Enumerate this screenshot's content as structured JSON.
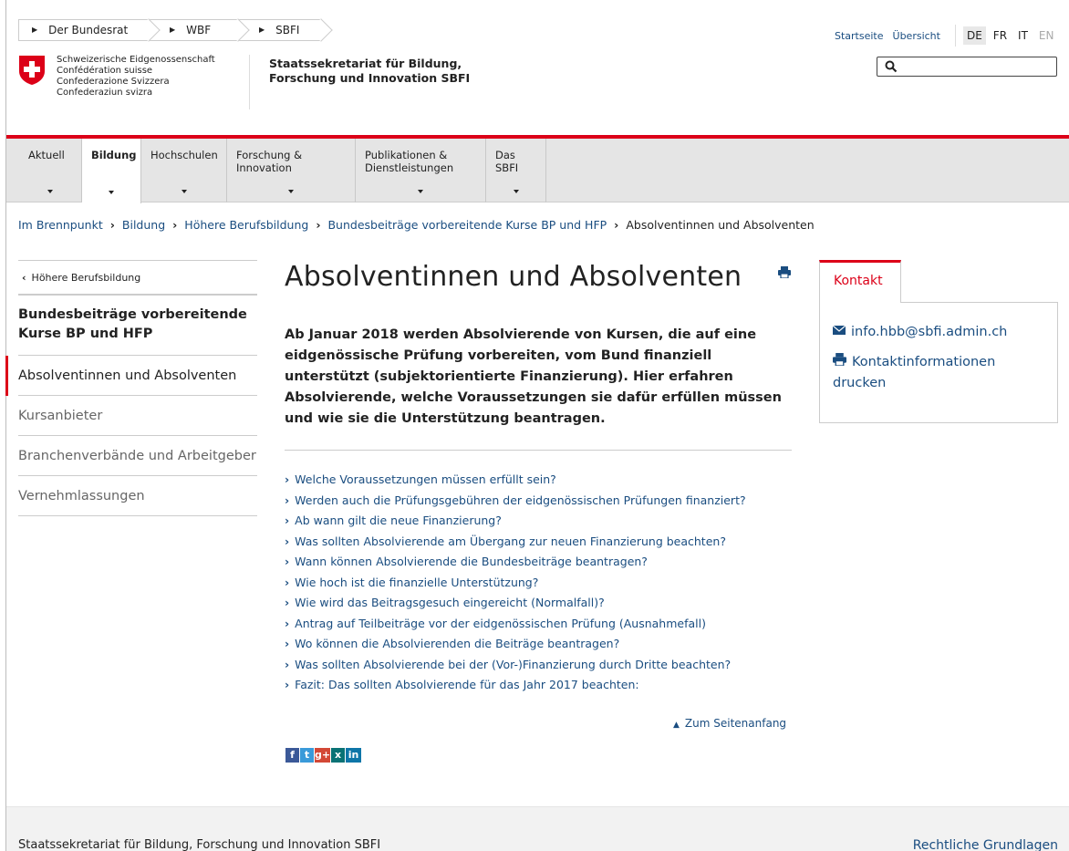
{
  "federal_breadcrumb": [
    "Der Bundesrat",
    "WBF",
    "SBFI"
  ],
  "meta_links": [
    "Startseite",
    "Übersicht"
  ],
  "languages": [
    "DE",
    "FR",
    "IT",
    "EN"
  ],
  "logo": {
    "lines": [
      "Schweizerische Eidgenossenschaft",
      "Confédération suisse",
      "Confederazione Svizzera",
      "Confederaziun svizra"
    ]
  },
  "department": {
    "line1": "Staatssekretariat für Bildung,",
    "line2": "Forschung und Innovation SBFI"
  },
  "search": {
    "placeholder": "",
    "value": ""
  },
  "nav": [
    {
      "line1": "Aktuell",
      "line2": ""
    },
    {
      "line1": "Bildung",
      "line2": ""
    },
    {
      "line1": "Hochschulen",
      "line2": ""
    },
    {
      "line1": "Forschung &",
      "line2": "Innovation"
    },
    {
      "line1": "Publikationen &",
      "line2": "Dienstleistungen"
    },
    {
      "line1": "Das SBFI",
      "line2": ""
    }
  ],
  "page_breadcrumb": [
    "Im Brennpunkt",
    "Bildung",
    "Höhere Berufsbildung",
    "Bundesbeiträge vorbereitende Kurse BP und HFP",
    "Absolventinnen und Absolventen"
  ],
  "left_nav": {
    "back": "Höhere Berufsbildung",
    "parent": "Bundesbeiträge vorbereitende Kurse BP und HFP",
    "items": [
      "Absolventinnen und Absolventen",
      "Kursanbieter",
      "Branchenverbände und Arbeitgeber",
      "Vernehmlassungen"
    ]
  },
  "main": {
    "title": "Absolventinnen und Absolventen",
    "lead": "Ab Januar 2018 werden Absolvierende von Kursen, die auf eine eidgenössische Prüfung vorbereiten, vom Bund finanziell unterstützt (subjektorientierte Finanzierung). Hier erfahren Absolvierende, welche Voraussetzungen sie dafür erfüllen müssen und wie sie die Unterstützung beantragen.",
    "toc": [
      "Welche Voraussetzungen müssen erfüllt sein?",
      "Werden auch die Prüfungsgebühren der eidgenössischen Prüfungen finanziert?",
      "Ab wann gilt die neue Finanzierung?",
      "Was sollten Absolvierende am Übergang zur neuen Finanzierung beachten?",
      "Wann können Absolvierende die Bundesbeiträge beantragen?",
      "Wie hoch ist die finanzielle Unterstützung?",
      "Wie wird das Beitragsgesuch eingereicht (Normalfall)?",
      "Antrag auf Teilbeiträge vor der eidgenössischen Prüfung (Ausnahmefall)",
      "Wo können die Absolvierenden die Beiträge beantragen?",
      "Was sollten Absolvierende bei der (Vor-)Finanzierung durch Dritte beachten?",
      "Fazit: Das sollten Absolvierende für das Jahr 2017 beachten:"
    ],
    "to_top": "Zum Seitenanfang"
  },
  "social": [
    "f",
    "t",
    "g+",
    "x",
    "in"
  ],
  "contact": {
    "tab": "Kontakt",
    "email": "info.hbb@sbfi.admin.ch",
    "print": "Kontaktinformationen drucken"
  },
  "footer": {
    "text": "Staatssekretariat für Bildung, Forschung und Innovation SBFI",
    "link": "Rechtliche Grundlagen"
  },
  "colors": {
    "accent_red": "#dc0018",
    "link_blue": "#1a4d80"
  }
}
